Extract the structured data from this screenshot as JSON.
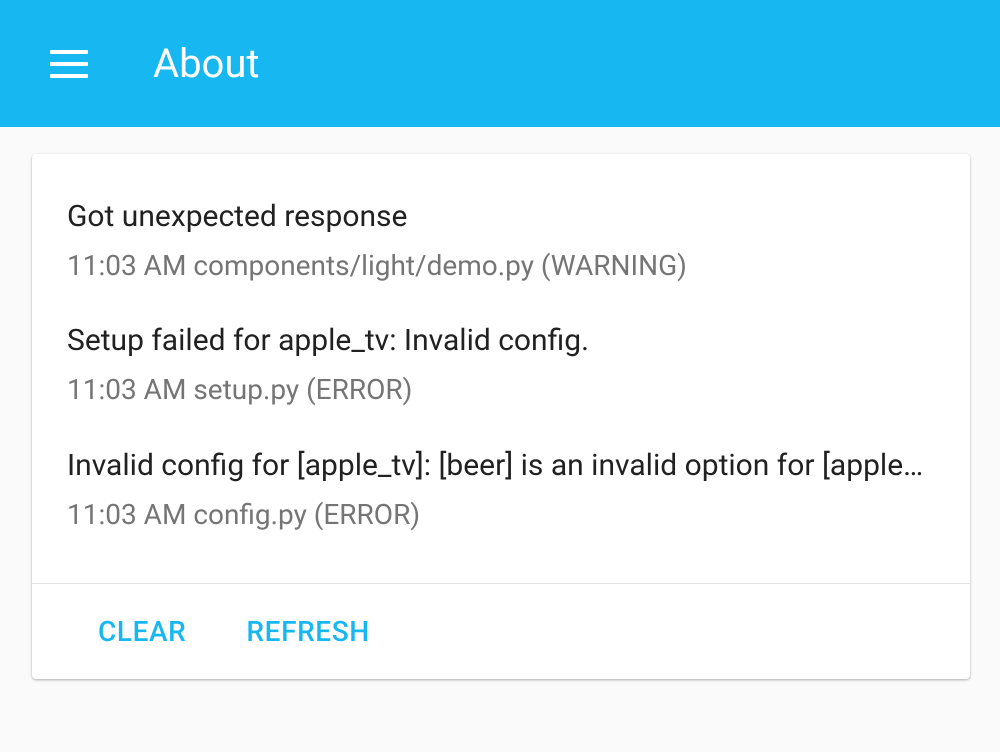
{
  "header": {
    "title": "About"
  },
  "logs": {
    "items": [
      {
        "message": "Got unexpected response",
        "detail": "11:03 AM components/light/demo.py (WARNING)"
      },
      {
        "message": "Setup failed for apple_tv: Invalid config.",
        "detail": "11:03 AM setup.py (ERROR)"
      },
      {
        "message": "Invalid config for [apple_tv]: [beer] is an invalid option for [apple_tv].",
        "detail": "11:03 AM config.py (ERROR)"
      }
    ]
  },
  "actions": {
    "clear": "CLEAR",
    "refresh": "REFRESH"
  },
  "colors": {
    "primary": "#17b8f1"
  }
}
